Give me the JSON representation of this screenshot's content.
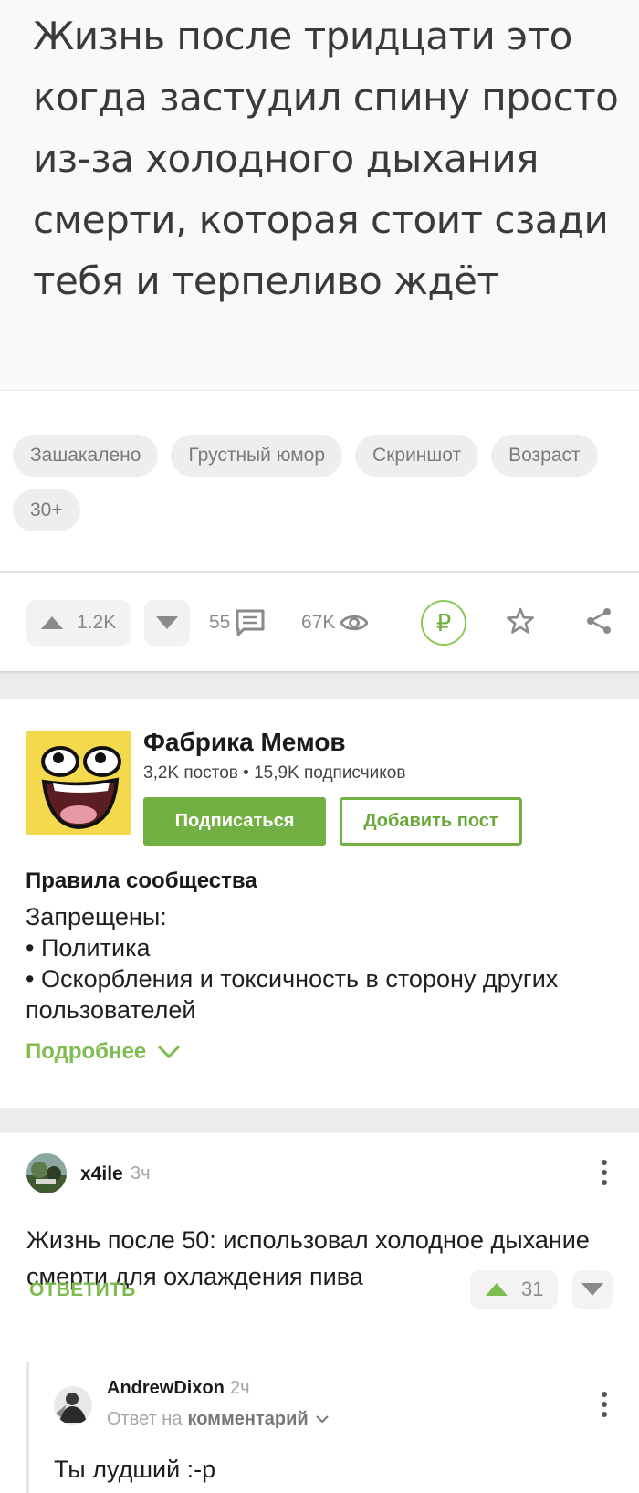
{
  "meme": {
    "text": "Жизнь после тридцати это когда застудил спину просто из-за холодного дыхания смерти, которая стоит сзади тебя и терпеливо ждёт"
  },
  "tags": [
    "Зашакалено",
    "Грустный юмор",
    "Скриншот",
    "Возраст",
    "30+"
  ],
  "actions": {
    "upvotes": "1.2K",
    "comments": "55",
    "views": "67K",
    "donate_symbol": "₽",
    "accent": "#73b043"
  },
  "community": {
    "name": "Фабрика Мемов",
    "stats": "3,2K постов • 15,9K подписчиков",
    "subscribe_label": "Подписаться",
    "add_post_label": "Добавить пост",
    "rules_title": "Правила сообщества",
    "rules_body": "Запрещены:\n• Политика\n• Оскорбления и токсичность в сторону других пользователей",
    "more_label": "Подробнее"
  },
  "comments": [
    {
      "author": "x4ile",
      "time": "3ч",
      "text": "Жизнь после 50: использовал холодное дыхание смерти для охлаждения пива",
      "reply_label": "ОТВЕТИТЬ",
      "votes": "31"
    },
    {
      "author": "AndrewDixon",
      "time": "2ч",
      "reply_prefix": "Ответ на",
      "reply_target": "комментарий",
      "text": "Ты лудший :-р"
    }
  ]
}
